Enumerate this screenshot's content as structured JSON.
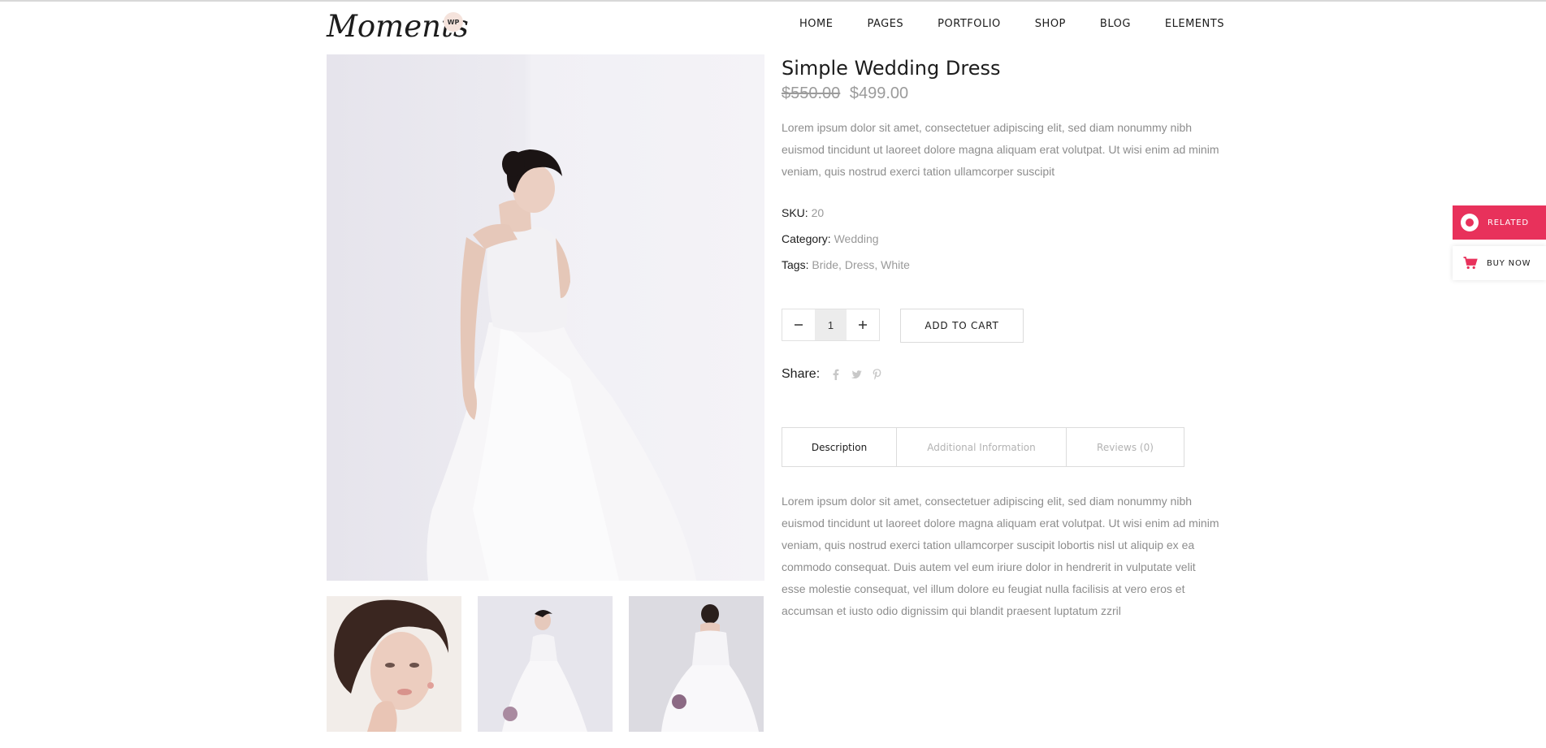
{
  "header": {
    "logo_text": "Moments",
    "logo_badge": "WP",
    "nav": [
      "HOME",
      "PAGES",
      "PORTFOLIO",
      "SHOP",
      "BLOG",
      "ELEMENTS"
    ]
  },
  "product": {
    "title": "Simple Wedding Dress",
    "old_price": "$550.00",
    "price": "$499.00",
    "short_description": "Lorem ipsum dolor sit amet, consectetuer adipiscing elit, sed diam nonummy nibh euismod tincidunt ut laoreet dolore magna aliquam erat volutpat. Ut wisi enim ad minim veniam, quis nostrud exerci tation ullamcorper suscipit",
    "sku_label": "SKU:",
    "sku": "20",
    "category_label": "Category:",
    "category": "Wedding",
    "tags_label": "Tags:",
    "tags": [
      "Bride",
      "Dress",
      "White"
    ],
    "quantity": "1",
    "add_to_cart": "ADD TO CART",
    "share_label": "Share:"
  },
  "tabs": [
    "Description",
    "Additional Information",
    "Reviews (0)"
  ],
  "long_description": "Lorem ipsum dolor sit amet, consectetuer adipiscing elit, sed diam nonummy nibh euismod tincidunt ut laoreet dolore magna aliquam erat volutpat. Ut wisi enim ad minim veniam, quis nostrud exerci tation ullamcorper suscipit lobortis nisl ut aliquip ex ea commodo consequat. Duis autem vel eum iriure dolor in hendrerit in vulputate velit esse molestie consequat, vel illum dolore eu feugiat nulla facilisis at vero eros et accumsan et iusto odio dignissim qui blandit praesent luptatum zzril",
  "side": {
    "related": "RELATED",
    "buy_now": "BUY NOW"
  },
  "colors": {
    "accent": "#e8315b",
    "muted_text": "#8d8d8d"
  }
}
